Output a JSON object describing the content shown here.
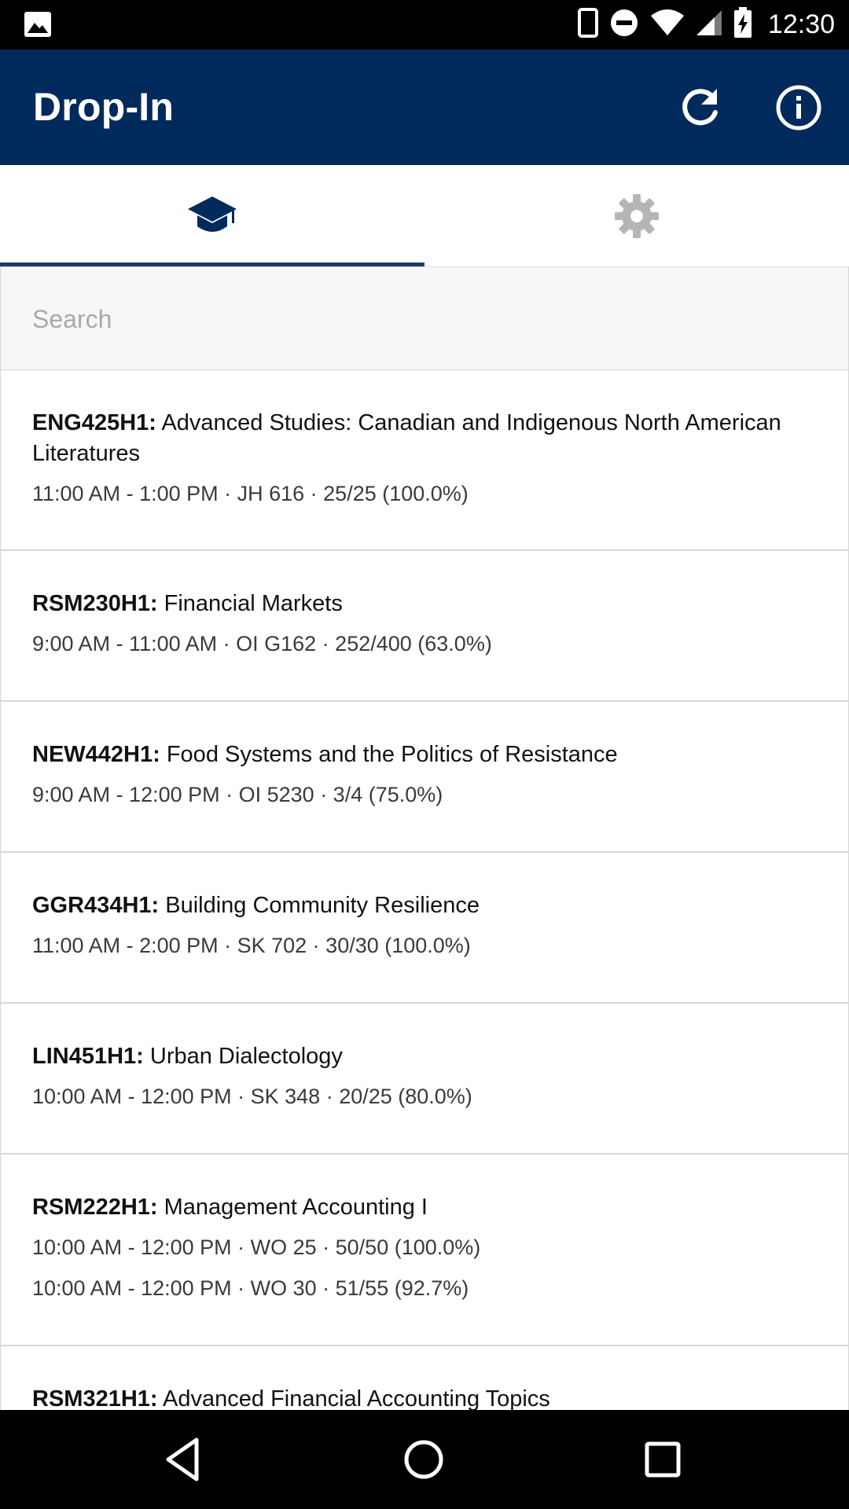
{
  "status_bar": {
    "time": "12:30",
    "icons": [
      "image-notification-icon",
      "phone-icon",
      "do-not-disturb-icon",
      "wifi-icon",
      "cell-signal-icon",
      "battery-charging-icon"
    ]
  },
  "app_bar": {
    "title": "Drop-In",
    "actions": [
      "refresh-icon",
      "info-icon"
    ],
    "color": "#002a5c"
  },
  "tabs": [
    {
      "icon": "graduation-cap-icon",
      "selected": true
    },
    {
      "icon": "gear-icon",
      "selected": false
    }
  ],
  "search": {
    "placeholder": "Search",
    "value": ""
  },
  "courses": [
    {
      "code": "ENG425H1:",
      "name": "Advanced Studies: Canadian and Indigenous North American Literatures",
      "sections": [
        "11:00 AM - 1:00 PM · JH 616 · 25/25 (100.0%)"
      ]
    },
    {
      "code": "RSM230H1:",
      "name": "Financial Markets",
      "sections": [
        "9:00 AM - 11:00 AM · OI G162 · 252/400 (63.0%)"
      ]
    },
    {
      "code": "NEW442H1:",
      "name": "Food Systems and the Politics of Resistance",
      "sections": [
        "9:00 AM - 12:00 PM · OI 5230 · 3/4 (75.0%)"
      ]
    },
    {
      "code": "GGR434H1:",
      "name": "Building Community Resilience",
      "sections": [
        "11:00 AM - 2:00 PM · SK 702 · 30/30 (100.0%)"
      ]
    },
    {
      "code": "LIN451H1:",
      "name": "Urban Dialectology",
      "sections": [
        "10:00 AM - 12:00 PM · SK 348 · 20/25 (80.0%)"
      ]
    },
    {
      "code": "RSM222H1:",
      "name": "Management Accounting I",
      "sections": [
        "10:00 AM - 12:00 PM · WO 25 · 50/50 (100.0%)",
        "10:00 AM - 12:00 PM · WO 30 · 51/55 (92.7%)"
      ]
    },
    {
      "code": "RSM321H1:",
      "name": "Advanced Financial Accounting Topics",
      "sections": []
    }
  ],
  "nav_bar": {
    "buttons": [
      "back-icon",
      "home-icon",
      "recents-icon"
    ]
  }
}
